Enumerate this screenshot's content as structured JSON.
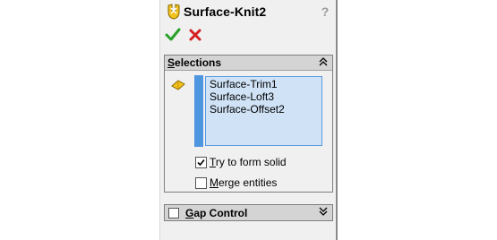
{
  "panel": {
    "title": "Surface-Knit2",
    "help_glyph": "?"
  },
  "actions": {
    "ok": "check-icon",
    "cancel": "x-icon"
  },
  "selections": {
    "header_underlined": "S",
    "header_rest": "elections",
    "items": [
      "Surface-Trim1",
      "Surface-Loft3",
      "Surface-Offset2"
    ],
    "try_to_form_solid": {
      "underlined": "T",
      "rest": "ry to form solid",
      "checked": true
    },
    "merge_entities": {
      "underlined": "M",
      "rest": "erge entities",
      "checked": false
    }
  },
  "gap_control": {
    "underlined": "G",
    "rest": "ap Control",
    "checked": false
  },
  "colors": {
    "ok": "#2aa02a",
    "cancel": "#d42020",
    "selection_bg": "#cfe2f6",
    "selection_stripe": "#4f96e0"
  }
}
